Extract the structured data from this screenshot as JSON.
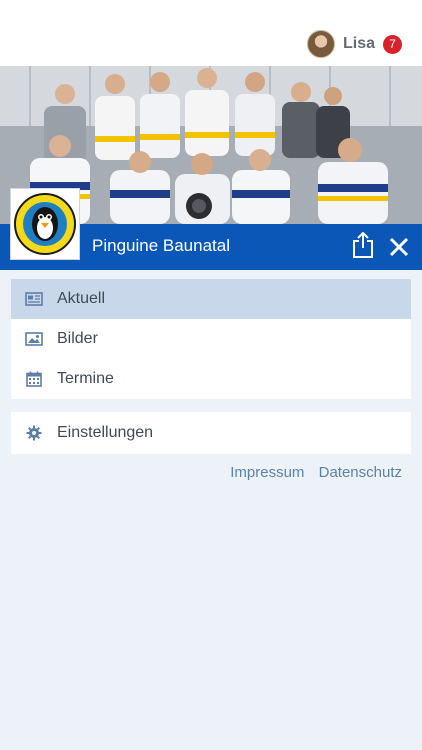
{
  "header": {
    "user_name": "Lisa",
    "notification_count": "7",
    "accent": "#d8232a"
  },
  "team": {
    "name": "Pinguine Baunatal",
    "logo_text": "Pinguine Baunatal",
    "bar_color": "#0a57b8"
  },
  "menu": {
    "items": [
      {
        "label": "Aktuell",
        "icon": "newspaper-icon",
        "active": true
      },
      {
        "label": "Bilder",
        "icon": "image-icon",
        "active": false
      },
      {
        "label": "Termine",
        "icon": "calendar-icon",
        "active": false
      }
    ],
    "settings_label": "Einstellungen",
    "settings_icon": "gear-icon"
  },
  "footer": {
    "impressum": "Impressum",
    "datenschutz": "Datenschutz"
  }
}
